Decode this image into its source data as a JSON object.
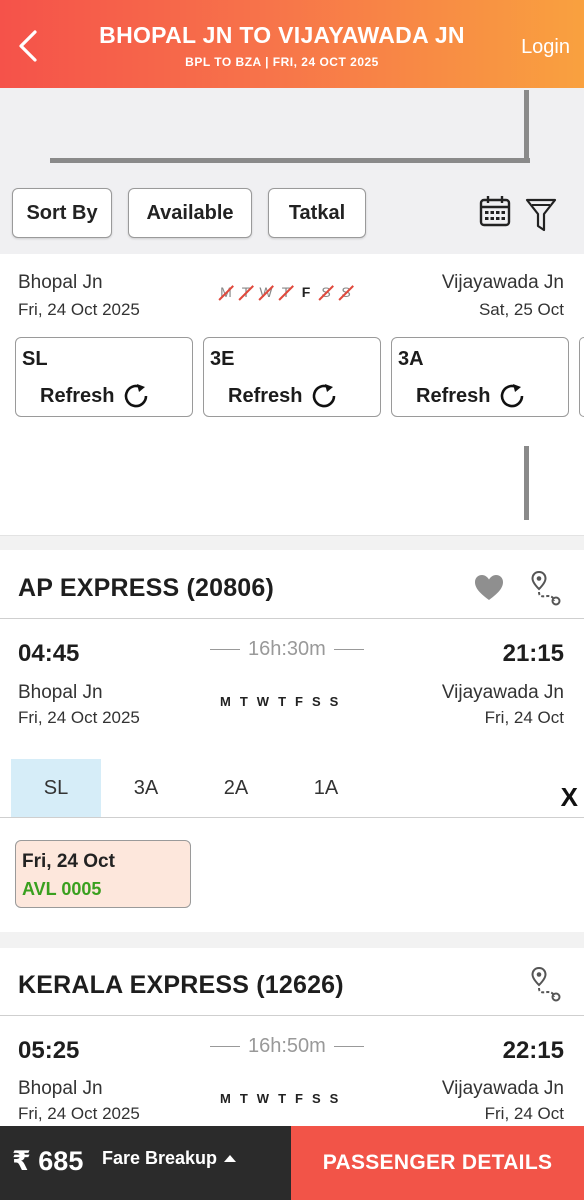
{
  "header": {
    "title": "BHOPAL  JN TO VIJAYAWADA JN",
    "subtitle": "BPL TO BZA | FRI, 24 OCT  2025",
    "login_label": "Login"
  },
  "toolbar": {
    "sort_label": "Sort By",
    "available_label": "Available",
    "tatkal_label": "Tatkal",
    "calendar_icon": "calendar-icon",
    "filter_icon": "filter-icon"
  },
  "route": {
    "from_station": "Bhopal  Jn",
    "from_date": "Fri, 24 Oct  2025",
    "to_station": "Vijayawada Jn",
    "to_date": "Sat, 25 Oct",
    "days": [
      {
        "label": "M",
        "runs": false
      },
      {
        "label": "T",
        "runs": false
      },
      {
        "label": "W",
        "runs": false
      },
      {
        "label": "T",
        "runs": false
      },
      {
        "label": "F",
        "runs": true
      },
      {
        "label": "S",
        "runs": false
      },
      {
        "label": "S",
        "runs": false
      }
    ],
    "classes": [
      {
        "name": "SL",
        "action": "Refresh"
      },
      {
        "name": "3E",
        "action": "Refresh"
      },
      {
        "name": "3A",
        "action": "Refresh"
      }
    ]
  },
  "trains": [
    {
      "name": "AP EXPRESS (20806)",
      "dep_time": "04:45",
      "arr_time": "21:15",
      "duration": "16h:30m",
      "from_station": "Bhopal  Jn",
      "from_date": "Fri, 24 Oct  2025",
      "to_station": "Vijayawada Jn",
      "to_date": "Fri, 24 Oct",
      "run_days": [
        "M",
        "T",
        "W",
        "T",
        "F",
        "S",
        "S"
      ],
      "tabs": [
        "SL",
        "3A",
        "2A",
        "1A"
      ],
      "close_label": "X",
      "availability": {
        "date": "Fri, 24 Oct",
        "status": "AVL 0005"
      }
    },
    {
      "name": "KERALA EXPRESS (12626)",
      "dep_time": "05:25",
      "arr_time": "22:15",
      "duration": "16h:50m",
      "from_station": "Bhopal  Jn",
      "from_date": "Fri, 24 Oct  2025",
      "to_station": "Vijayawada Jn",
      "to_date": "Fri, 24 Oct",
      "run_days": [
        "M",
        "T",
        "W",
        "T",
        "F",
        "S",
        "S"
      ]
    }
  ],
  "bottom_bar": {
    "fare": "₹ 685",
    "fare_breakup_label": "Fare Breakup",
    "passenger_details_label": "PASSENGER DETAILS"
  },
  "colors": {
    "header_gradient_start": "#f5524a",
    "header_gradient_end": "#f9a13f",
    "accent_red": "#f25448",
    "available_green": "#3aa01f",
    "active_tab_bg": "#d6edf8",
    "avl_box_bg": "#fde7dc"
  }
}
